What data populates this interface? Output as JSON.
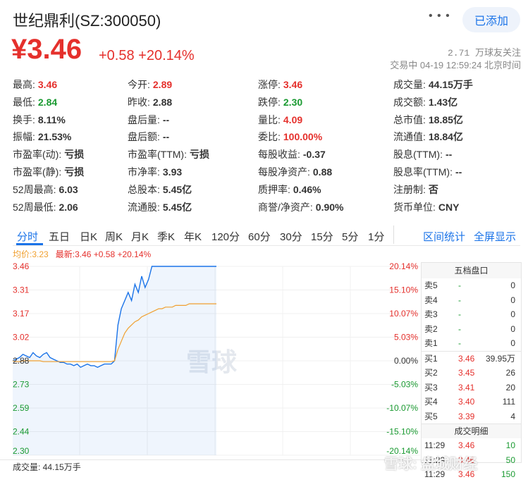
{
  "header": {
    "title": "世纪鼎利(SZ:300050)",
    "more_icon": "more-dots-icon",
    "add_button": "已添加",
    "price": "¥3.46",
    "change": "+0.58",
    "change_pct": "+20.14%",
    "followers": "2.71 万球友关注",
    "status_time": "交易中 04-19 12:59:24 北京时间"
  },
  "stats": [
    [
      {
        "label": "最高:",
        "value": "3.46",
        "color": "red"
      },
      {
        "label": "今开:",
        "value": "2.89",
        "color": "red"
      },
      {
        "label": "涨停:",
        "value": "3.46",
        "color": "red"
      },
      {
        "label": "成交量:",
        "value": "44.15万手",
        "color": "black"
      }
    ],
    [
      {
        "label": "最低:",
        "value": "2.84",
        "color": "green"
      },
      {
        "label": "昨收:",
        "value": "2.88",
        "color": "black"
      },
      {
        "label": "跌停:",
        "value": "2.30",
        "color": "green"
      },
      {
        "label": "成交额:",
        "value": "1.43亿",
        "color": "black"
      }
    ],
    [
      {
        "label": "换手:",
        "value": "8.11%",
        "color": "black"
      },
      {
        "label": "盘后量:",
        "value": "--",
        "color": "black"
      },
      {
        "label": "量比:",
        "value": "4.09",
        "color": "red"
      },
      {
        "label": "总市值:",
        "value": "18.85亿",
        "color": "black"
      }
    ],
    [
      {
        "label": "振幅:",
        "value": "21.53%",
        "color": "black"
      },
      {
        "label": "盘后额:",
        "value": "--",
        "color": "black"
      },
      {
        "label": "委比:",
        "value": "100.00%",
        "color": "red"
      },
      {
        "label": "流通值:",
        "value": "18.84亿",
        "color": "black"
      }
    ],
    [
      {
        "label": "市盈率(动):",
        "value": "亏损",
        "color": "black"
      },
      {
        "label": "市盈率(TTM):",
        "value": "亏损",
        "color": "black"
      },
      {
        "label": "每股收益:",
        "value": "-0.37",
        "color": "black"
      },
      {
        "label": "股息(TTM):",
        "value": "--",
        "color": "black"
      }
    ],
    [
      {
        "label": "市盈率(静):",
        "value": "亏损",
        "color": "black"
      },
      {
        "label": "市净率:",
        "value": "3.93",
        "color": "black"
      },
      {
        "label": "每股净资产:",
        "value": "0.88",
        "color": "black"
      },
      {
        "label": "股息率(TTM):",
        "value": "--",
        "color": "black"
      }
    ],
    [
      {
        "label": "52周最高:",
        "value": "6.03",
        "color": "black"
      },
      {
        "label": "总股本:",
        "value": "5.45亿",
        "color": "black"
      },
      {
        "label": "质押率:",
        "value": "0.46%",
        "color": "black"
      },
      {
        "label": "注册制:",
        "value": "否",
        "color": "black"
      }
    ],
    [
      {
        "label": "52周最低:",
        "value": "2.06",
        "color": "black"
      },
      {
        "label": "流通股:",
        "value": "5.45亿",
        "color": "black"
      },
      {
        "label": "商誉/净资产:",
        "value": "0.90%",
        "color": "black"
      },
      {
        "label": "货币单位:",
        "value": "CNY",
        "color": "black"
      }
    ]
  ],
  "tabs": [
    "分时",
    "五日",
    "日K",
    "周K",
    "月K",
    "季K",
    "年K",
    "120分",
    "60分",
    "30分",
    "15分",
    "5分",
    "1分"
  ],
  "active_tab": "分时",
  "tab_links": [
    "区间统计",
    "全屏显示"
  ],
  "legend": {
    "avg_label": "均价:",
    "avg_value": "3.23",
    "latest_label": "最新:",
    "latest_value": "3.46 +0.58 +20.14%"
  },
  "y_labels_left": [
    "3.46",
    "3.31",
    "3.17",
    "3.02",
    "2.88",
    "2.73",
    "2.59",
    "2.44",
    "2.30"
  ],
  "y_labels_right": [
    "20.14%",
    "15.10%",
    "10.07%",
    "5.03%",
    "0.00%",
    "-5.03%",
    "-10.07%",
    "-15.10%",
    "-20.14%"
  ],
  "watermark": "雪球",
  "order_book": {
    "title": "五档盘口",
    "asks": [
      {
        "label": "卖5",
        "price": "-",
        "vol": "0"
      },
      {
        "label": "卖4",
        "price": "-",
        "vol": "0"
      },
      {
        "label": "卖3",
        "price": "-",
        "vol": "0"
      },
      {
        "label": "卖2",
        "price": "-",
        "vol": "0"
      },
      {
        "label": "卖1",
        "price": "-",
        "vol": "0"
      }
    ],
    "bids": [
      {
        "label": "买1",
        "price": "3.46",
        "vol": "39.95万"
      },
      {
        "label": "买2",
        "price": "3.45",
        "vol": "26"
      },
      {
        "label": "买3",
        "price": "3.41",
        "vol": "20"
      },
      {
        "label": "买4",
        "price": "3.40",
        "vol": "111"
      },
      {
        "label": "买5",
        "price": "3.39",
        "vol": "4"
      }
    ]
  },
  "trades": {
    "title": "成交明细",
    "rows": [
      {
        "time": "11:29",
        "price": "3.46",
        "vol": "10"
      },
      {
        "time": "11:29",
        "price": "3.46",
        "vol": "50"
      },
      {
        "time": "11:29",
        "price": "3.46",
        "vol": "150"
      }
    ]
  },
  "volume_label": "成交量: 44.15万手",
  "corner_watermark": "雪球: 盘城财经",
  "colors": {
    "up": "#e5302c",
    "down": "#1a9a31",
    "accent": "#1a73e8",
    "price_line": "#1a73e8",
    "avg_line": "#f0a030"
  },
  "chart_data": {
    "type": "line",
    "title": "",
    "ylim": [
      2.3,
      3.46
    ],
    "prev_close": 2.88,
    "x_range_fraction": 0.5,
    "series": [
      {
        "values": [
          2.88,
          2.89,
          2.9,
          2.92,
          2.91,
          2.9,
          2.93,
          2.91,
          2.9,
          2.92,
          2.93,
          2.9,
          2.89,
          2.88,
          2.87,
          2.87,
          2.86,
          2.86,
          2.85,
          2.86,
          2.84,
          2.85,
          2.86,
          2.85,
          2.85,
          2.84,
          2.85,
          2.86,
          2.86,
          2.86,
          2.88,
          3.1,
          3.2,
          3.25,
          3.3,
          3.25,
          3.35,
          3.3,
          3.4,
          3.33,
          3.38,
          3.46,
          3.46,
          3.46,
          3.46,
          3.46,
          3.46,
          3.46,
          3.46,
          3.46,
          3.46,
          3.46,
          3.46,
          3.46,
          3.46,
          3.46,
          3.46,
          3.46,
          3.46,
          3.46,
          3.46
        ]
      },
      {
        "values": [
          2.88,
          2.875,
          2.875,
          2.88,
          2.88,
          2.88,
          2.88,
          2.88,
          2.88,
          2.875,
          2.875,
          2.875,
          2.875,
          2.875,
          2.875,
          2.875,
          2.875,
          2.875,
          2.875,
          2.875,
          2.875,
          2.875,
          2.875,
          2.875,
          2.875,
          2.875,
          2.875,
          2.875,
          2.875,
          2.875,
          2.88,
          2.95,
          3.0,
          3.05,
          3.08,
          3.1,
          3.12,
          3.13,
          3.15,
          3.16,
          3.17,
          3.18,
          3.19,
          3.2,
          3.2,
          3.21,
          3.21,
          3.21,
          3.22,
          3.22,
          3.22,
          3.22,
          3.23,
          3.23,
          3.23,
          3.23,
          3.23,
          3.23,
          3.23,
          3.23,
          3.23
        ]
      }
    ]
  }
}
